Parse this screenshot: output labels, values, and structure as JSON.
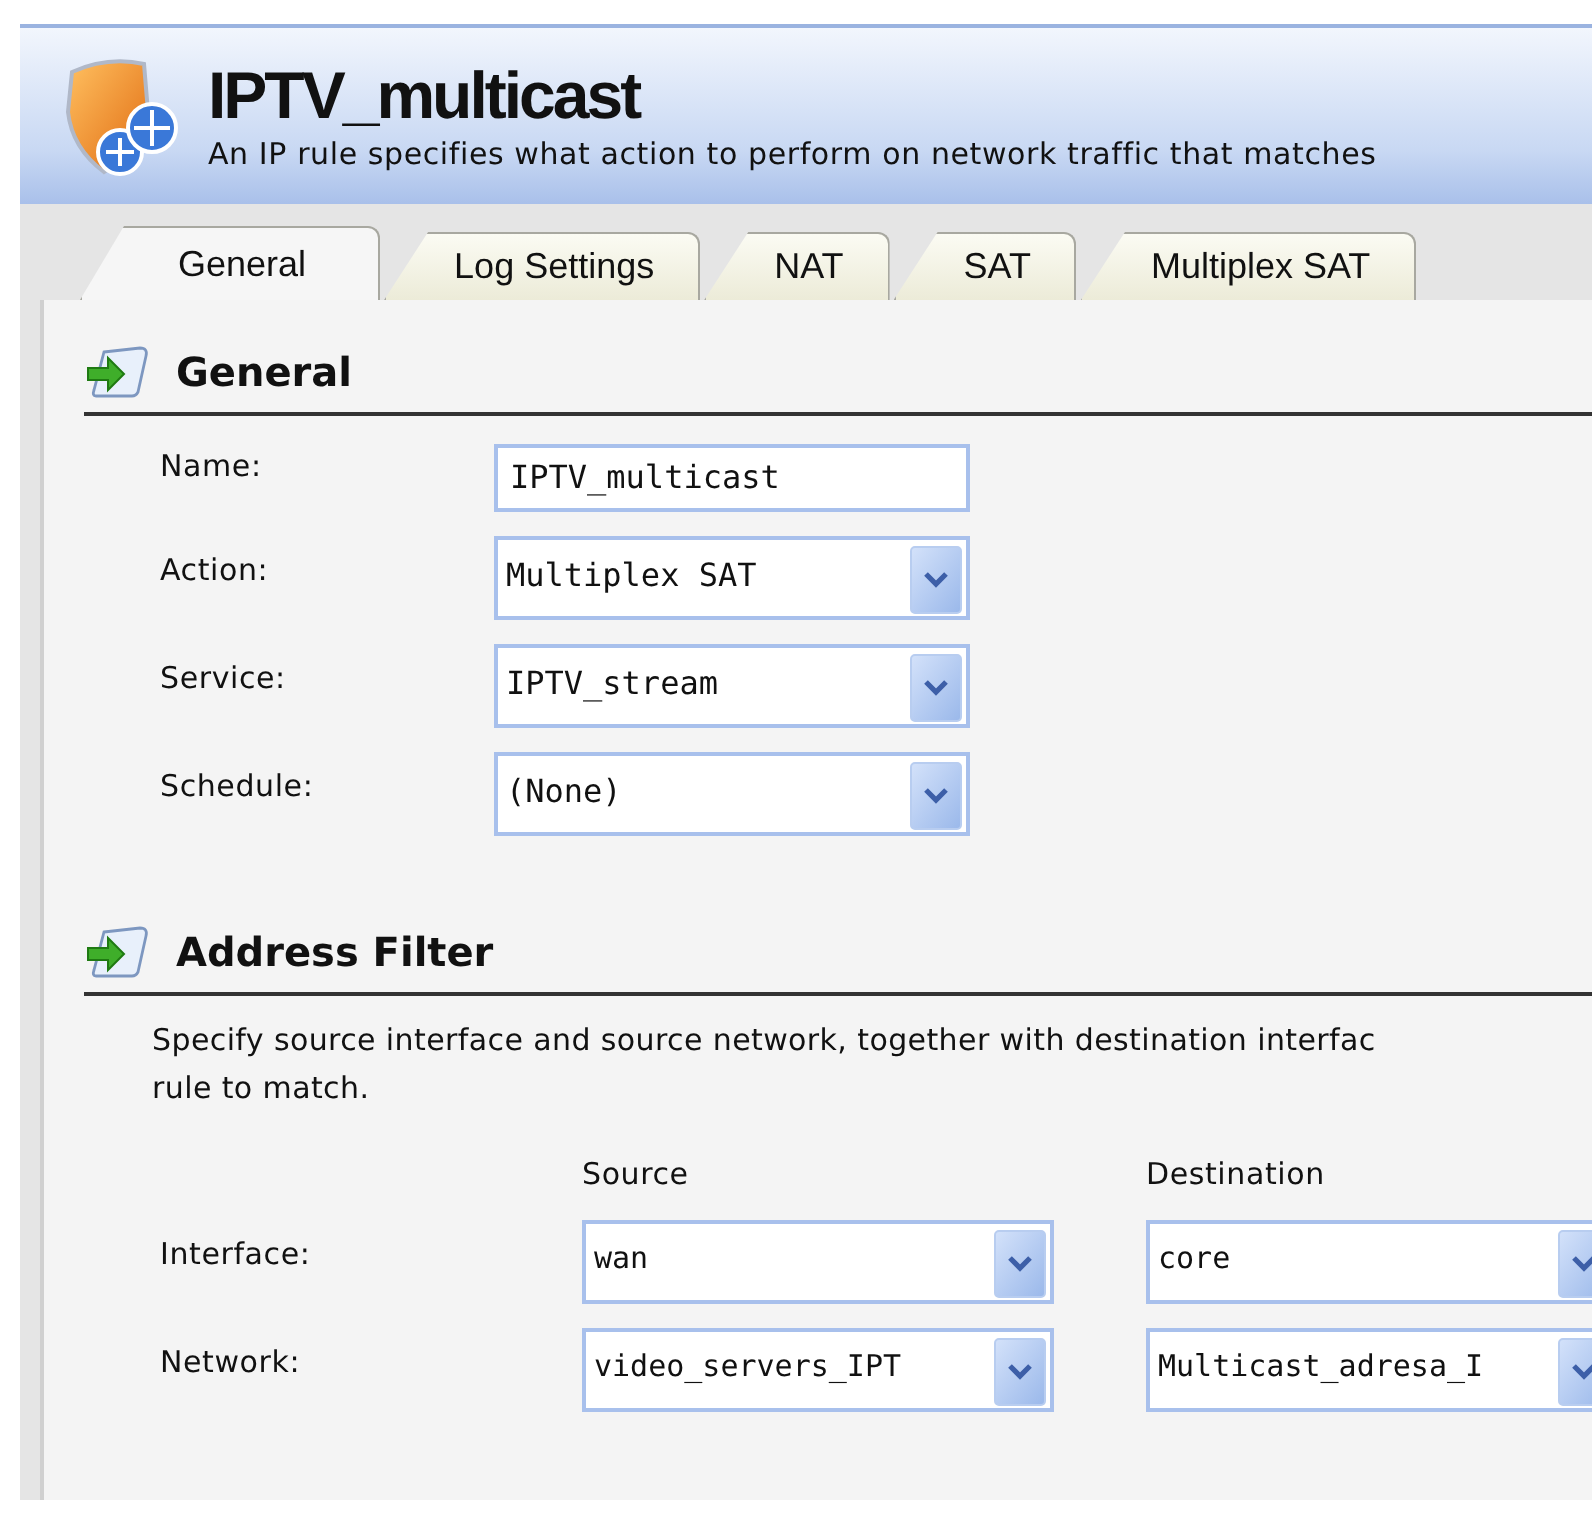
{
  "header": {
    "title": "IPTV_multicast",
    "description": "An IP rule specifies what action to perform on network traffic that matches"
  },
  "tabs": [
    {
      "label": "General",
      "selected": true
    },
    {
      "label": "Log Settings",
      "selected": false
    },
    {
      "label": "NAT",
      "selected": false
    },
    {
      "label": "SAT",
      "selected": false
    },
    {
      "label": "Multiplex SAT",
      "selected": false
    }
  ],
  "sections": [
    {
      "title": "General",
      "kind": "form",
      "fields": [
        {
          "label": "Name:",
          "kind": "text",
          "value": "IPTV_multicast"
        },
        {
          "label": "Action:",
          "kind": "select",
          "value": "Multiplex SAT"
        },
        {
          "label": "Service:",
          "kind": "select",
          "value": "IPTV_stream"
        },
        {
          "label": "Schedule:",
          "kind": "select",
          "value": "(None)"
        }
      ]
    },
    {
      "title": "Address Filter",
      "kind": "grid",
      "description": "Specify source interface and source network, together with destination interfac\nrule to match.",
      "columns": [
        "Source",
        "Destination"
      ],
      "rows": [
        {
          "label": "Interface:",
          "values": [
            "wan",
            "core"
          ]
        },
        {
          "label": "Network:",
          "values": [
            "video_servers_IPT",
            "Multicast_adresa_I"
          ]
        }
      ]
    }
  ]
}
